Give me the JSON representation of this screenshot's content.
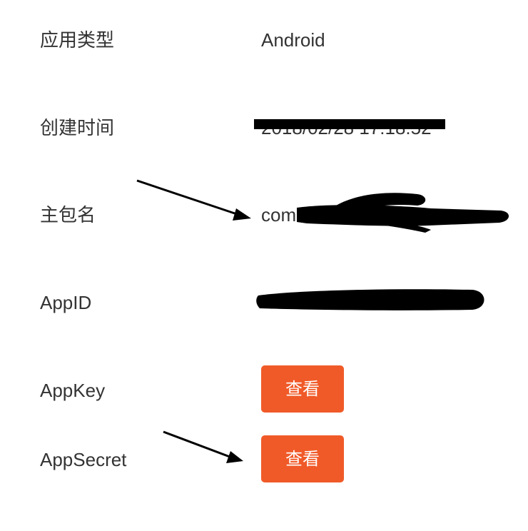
{
  "details": {
    "app_type": {
      "label": "应用类型",
      "value": "Android"
    },
    "created_time": {
      "label": "创建时间",
      "value": "2018/02/28 17:18:52"
    },
    "package_name": {
      "label": "主包名",
      "value": "com."
    },
    "app_id": {
      "label": "AppID"
    },
    "app_key": {
      "label": "AppKey",
      "button_label": "查看"
    },
    "app_secret": {
      "label": "AppSecret",
      "button_label": "查看"
    }
  },
  "colors": {
    "button_bg": "#f05a28",
    "button_text": "#ffffff",
    "text": "#333333",
    "redaction": "#000000"
  }
}
